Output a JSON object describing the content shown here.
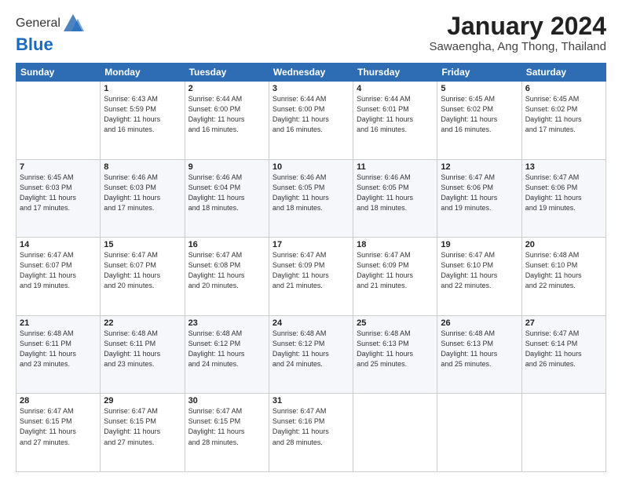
{
  "header": {
    "logo": {
      "line1": "General",
      "line2": "Blue"
    },
    "title": "January 2024",
    "subtitle": "Sawaengha, Ang Thong, Thailand"
  },
  "days_of_week": [
    "Sunday",
    "Monday",
    "Tuesday",
    "Wednesday",
    "Thursday",
    "Friday",
    "Saturday"
  ],
  "weeks": [
    [
      {
        "day": "",
        "info": ""
      },
      {
        "day": "1",
        "info": "Sunrise: 6:43 AM\nSunset: 5:59 PM\nDaylight: 11 hours\nand 16 minutes."
      },
      {
        "day": "2",
        "info": "Sunrise: 6:44 AM\nSunset: 6:00 PM\nDaylight: 11 hours\nand 16 minutes."
      },
      {
        "day": "3",
        "info": "Sunrise: 6:44 AM\nSunset: 6:00 PM\nDaylight: 11 hours\nand 16 minutes."
      },
      {
        "day": "4",
        "info": "Sunrise: 6:44 AM\nSunset: 6:01 PM\nDaylight: 11 hours\nand 16 minutes."
      },
      {
        "day": "5",
        "info": "Sunrise: 6:45 AM\nSunset: 6:02 PM\nDaylight: 11 hours\nand 16 minutes."
      },
      {
        "day": "6",
        "info": "Sunrise: 6:45 AM\nSunset: 6:02 PM\nDaylight: 11 hours\nand 17 minutes."
      }
    ],
    [
      {
        "day": "7",
        "info": "Sunrise: 6:45 AM\nSunset: 6:03 PM\nDaylight: 11 hours\nand 17 minutes."
      },
      {
        "day": "8",
        "info": "Sunrise: 6:46 AM\nSunset: 6:03 PM\nDaylight: 11 hours\nand 17 minutes."
      },
      {
        "day": "9",
        "info": "Sunrise: 6:46 AM\nSunset: 6:04 PM\nDaylight: 11 hours\nand 18 minutes."
      },
      {
        "day": "10",
        "info": "Sunrise: 6:46 AM\nSunset: 6:05 PM\nDaylight: 11 hours\nand 18 minutes."
      },
      {
        "day": "11",
        "info": "Sunrise: 6:46 AM\nSunset: 6:05 PM\nDaylight: 11 hours\nand 18 minutes."
      },
      {
        "day": "12",
        "info": "Sunrise: 6:47 AM\nSunset: 6:06 PM\nDaylight: 11 hours\nand 19 minutes."
      },
      {
        "day": "13",
        "info": "Sunrise: 6:47 AM\nSunset: 6:06 PM\nDaylight: 11 hours\nand 19 minutes."
      }
    ],
    [
      {
        "day": "14",
        "info": "Sunrise: 6:47 AM\nSunset: 6:07 PM\nDaylight: 11 hours\nand 19 minutes."
      },
      {
        "day": "15",
        "info": "Sunrise: 6:47 AM\nSunset: 6:07 PM\nDaylight: 11 hours\nand 20 minutes."
      },
      {
        "day": "16",
        "info": "Sunrise: 6:47 AM\nSunset: 6:08 PM\nDaylight: 11 hours\nand 20 minutes."
      },
      {
        "day": "17",
        "info": "Sunrise: 6:47 AM\nSunset: 6:09 PM\nDaylight: 11 hours\nand 21 minutes."
      },
      {
        "day": "18",
        "info": "Sunrise: 6:47 AM\nSunset: 6:09 PM\nDaylight: 11 hours\nand 21 minutes."
      },
      {
        "day": "19",
        "info": "Sunrise: 6:47 AM\nSunset: 6:10 PM\nDaylight: 11 hours\nand 22 minutes."
      },
      {
        "day": "20",
        "info": "Sunrise: 6:48 AM\nSunset: 6:10 PM\nDaylight: 11 hours\nand 22 minutes."
      }
    ],
    [
      {
        "day": "21",
        "info": "Sunrise: 6:48 AM\nSunset: 6:11 PM\nDaylight: 11 hours\nand 23 minutes."
      },
      {
        "day": "22",
        "info": "Sunrise: 6:48 AM\nSunset: 6:11 PM\nDaylight: 11 hours\nand 23 minutes."
      },
      {
        "day": "23",
        "info": "Sunrise: 6:48 AM\nSunset: 6:12 PM\nDaylight: 11 hours\nand 24 minutes."
      },
      {
        "day": "24",
        "info": "Sunrise: 6:48 AM\nSunset: 6:12 PM\nDaylight: 11 hours\nand 24 minutes."
      },
      {
        "day": "25",
        "info": "Sunrise: 6:48 AM\nSunset: 6:13 PM\nDaylight: 11 hours\nand 25 minutes."
      },
      {
        "day": "26",
        "info": "Sunrise: 6:48 AM\nSunset: 6:13 PM\nDaylight: 11 hours\nand 25 minutes."
      },
      {
        "day": "27",
        "info": "Sunrise: 6:47 AM\nSunset: 6:14 PM\nDaylight: 11 hours\nand 26 minutes."
      }
    ],
    [
      {
        "day": "28",
        "info": "Sunrise: 6:47 AM\nSunset: 6:15 PM\nDaylight: 11 hours\nand 27 minutes."
      },
      {
        "day": "29",
        "info": "Sunrise: 6:47 AM\nSunset: 6:15 PM\nDaylight: 11 hours\nand 27 minutes."
      },
      {
        "day": "30",
        "info": "Sunrise: 6:47 AM\nSunset: 6:15 PM\nDaylight: 11 hours\nand 28 minutes."
      },
      {
        "day": "31",
        "info": "Sunrise: 6:47 AM\nSunset: 6:16 PM\nDaylight: 11 hours\nand 28 minutes."
      },
      {
        "day": "",
        "info": ""
      },
      {
        "day": "",
        "info": ""
      },
      {
        "day": "",
        "info": ""
      }
    ]
  ]
}
